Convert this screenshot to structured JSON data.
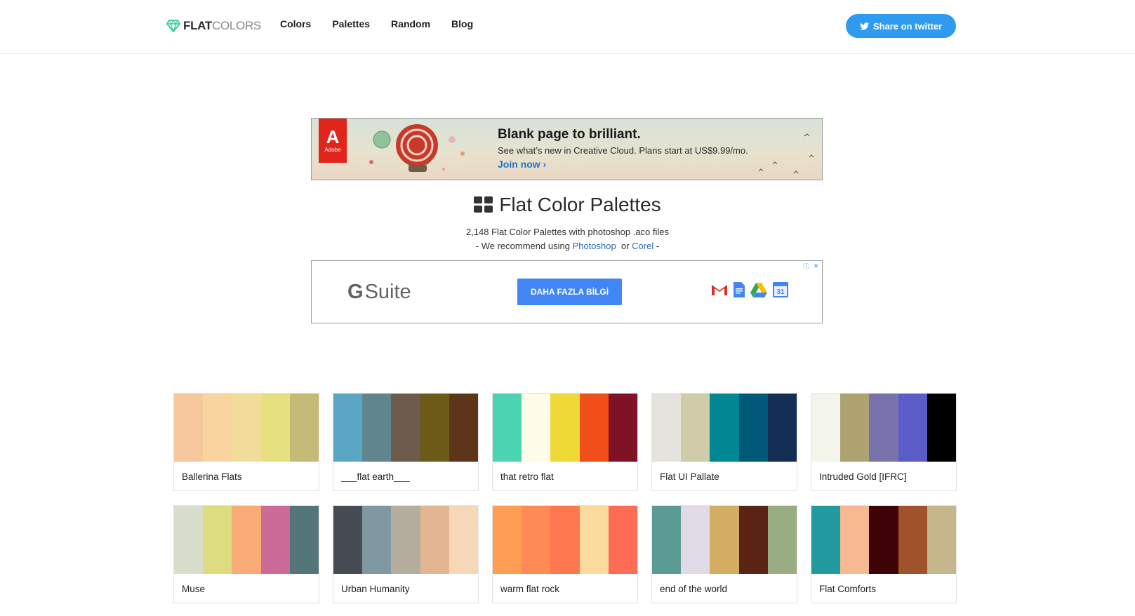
{
  "header": {
    "logo_bold": "FLAT",
    "logo_light": "COLORS",
    "nav": [
      {
        "label": "Colors"
      },
      {
        "label": "Palettes"
      },
      {
        "label": "Random"
      },
      {
        "label": "Blog"
      }
    ],
    "share_label": "Share on twitter",
    "share_color": "#2e9bf0"
  },
  "ad_top": {
    "brand": "Adobe",
    "headline": "Blank page to brilliant.",
    "sub": "See what’s new in Creative Cloud. Plans start at US$9.99/mo.",
    "cta": "Join now ›"
  },
  "main": {
    "title": "Flat Color Palettes",
    "subtitle": "2,148 Flat Color Palettes with photoshop .aco files",
    "recommend_prefix": "- We recommend using",
    "recommend_link1": "Photoshop",
    "recommend_or": "or",
    "recommend_link2": "Corel",
    "recommend_suffix": "-"
  },
  "ad_gsuite": {
    "brand_g": "G",
    "brand_rest": "Suite",
    "cta": "DAHA FAZLA BİLGİ",
    "calendar_day": "31"
  },
  "palettes": [
    {
      "name": "Ballerina Flats",
      "colors": [
        "#f7c89b",
        "#fad49e",
        "#f2dc9c",
        "#e6e07f",
        "#c4bb76"
      ]
    },
    {
      "name": "___flat earth___",
      "colors": [
        "#5aa7c5",
        "#60858d",
        "#6d5b4b",
        "#6b5a18",
        "#5d361a"
      ]
    },
    {
      "name": "that retro flat",
      "colors": [
        "#4bd4b2",
        "#fefdea",
        "#efd937",
        "#f14f1a",
        "#7f1325"
      ]
    },
    {
      "name": "Flat UI Pallate",
      "colors": [
        "#e4e3de",
        "#d0cba8",
        "#028794",
        "#005978",
        "#142e54"
      ]
    },
    {
      "name": "Intruded Gold [IFRC]",
      "colors": [
        "#f3f4ea",
        "#ada270",
        "#7872ad",
        "#5b5cc8",
        "#000000"
      ]
    },
    {
      "name": "Muse",
      "colors": [
        "#d9ddcc",
        "#dedc81",
        "#f9ab76",
        "#cc6b97",
        "#557679"
      ]
    },
    {
      "name": "Urban Humanity",
      "colors": [
        "#454c54",
        "#7f98a2",
        "#b5ad9e",
        "#e3b692",
        "#f6d8b8"
      ]
    },
    {
      "name": "warm flat rock",
      "colors": [
        "#fe9d53",
        "#fe8a55",
        "#fe784f",
        "#fadb9d",
        "#fe6c55"
      ]
    },
    {
      "name": "end of the world",
      "colors": [
        "#5a9c94",
        "#e0dbe7",
        "#d3ad61",
        "#5a2314",
        "#99ad83"
      ]
    },
    {
      "name": "Flat Comforts",
      "colors": [
        "#239b9e",
        "#f6b992",
        "#3f0206",
        "#a0522b",
        "#c6b68c"
      ]
    }
  ]
}
